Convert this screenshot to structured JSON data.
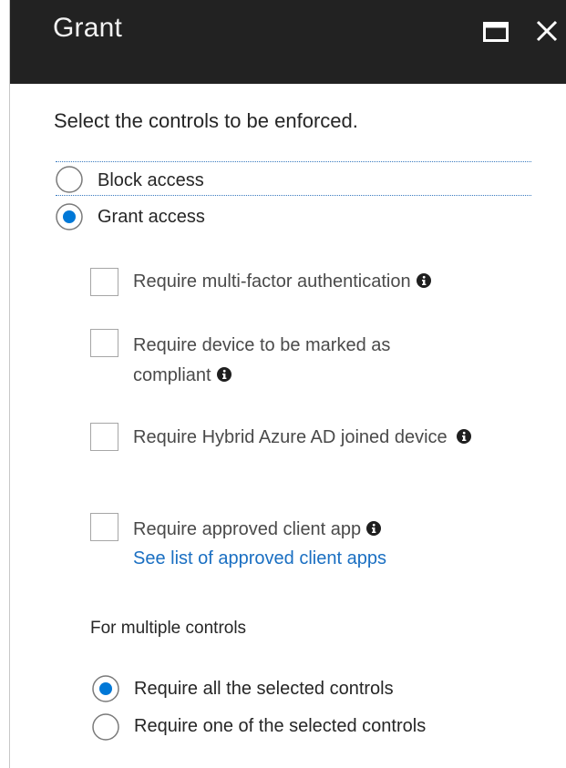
{
  "header": {
    "title": "Grant",
    "maximize_icon": "maximize-icon",
    "close_icon": "close-icon"
  },
  "prompt": "Select the controls to be enforced.",
  "access": {
    "options": [
      {
        "label": "Block access",
        "selected": false
      },
      {
        "label": "Grant access",
        "selected": true
      }
    ]
  },
  "controls": [
    {
      "label": "Require multi-factor authentication",
      "checked": false,
      "info_icon": "info-icon"
    },
    {
      "label": "Require device to be marked as compliant",
      "checked": false,
      "info_icon": "info-icon"
    },
    {
      "label": "Require Hybrid Azure AD joined device",
      "checked": false,
      "info_icon": "info-icon"
    },
    {
      "label": "Require approved client app",
      "checked": false,
      "info_icon": "info-icon",
      "link": "See list of approved client apps"
    }
  ],
  "multiple": {
    "title": "For multiple controls",
    "options": [
      {
        "label": "Require all the selected controls",
        "selected": true
      },
      {
        "label": "Require one of the selected controls",
        "selected": false
      }
    ]
  },
  "colors": {
    "header_bg": "#222222",
    "accent": "#0078d7",
    "link": "#1a6fc2"
  }
}
